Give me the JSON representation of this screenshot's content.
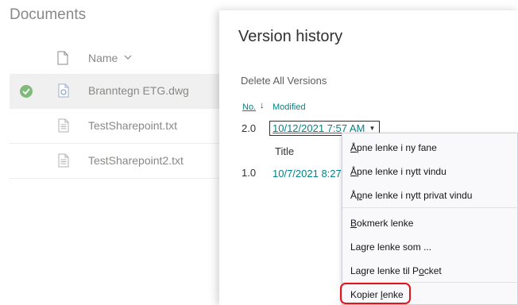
{
  "library": {
    "title": "Documents",
    "column_name": "Name",
    "files": [
      {
        "name": "Branntegn ETG.dwg",
        "selected": true
      },
      {
        "name": "TestSharepoint.txt",
        "selected": false
      },
      {
        "name": "TestSharepoint2.txt",
        "selected": false
      }
    ]
  },
  "panel": {
    "title": "Version history",
    "delete_all": "Delete All Versions",
    "header_no": "No.",
    "header_modified": "Modified",
    "versions": [
      {
        "no": "2.0",
        "modified": "10/12/2021 7:57 AM"
      },
      {
        "no": "1.0",
        "modified": "10/7/2021 8:27"
      }
    ],
    "title_label": "Title"
  },
  "context_menu": {
    "items": [
      {
        "pre": "",
        "key": "Å",
        "post": "pne lenke i ny fane"
      },
      {
        "pre": "",
        "key": "Å",
        "post": "pne lenke i nytt vindu"
      },
      {
        "pre": "Å",
        "key": "p",
        "post": "ne lenke i nytt privat vindu"
      },
      {
        "pre": "",
        "key": "B",
        "post": "okmerk lenke"
      },
      {
        "pre": "Lagre lenke som ",
        "key": "",
        "post": "..."
      },
      {
        "pre": "Lagre lenke til P",
        "key": "o",
        "post": "cket"
      },
      {
        "pre": "Kopier ",
        "key": "l",
        "post": "enke"
      }
    ],
    "highlighted_item": "Kopier lenke",
    "highlight_color": "#e0161d"
  },
  "colors": {
    "accent": "#038387",
    "check": "#7fba7a"
  }
}
